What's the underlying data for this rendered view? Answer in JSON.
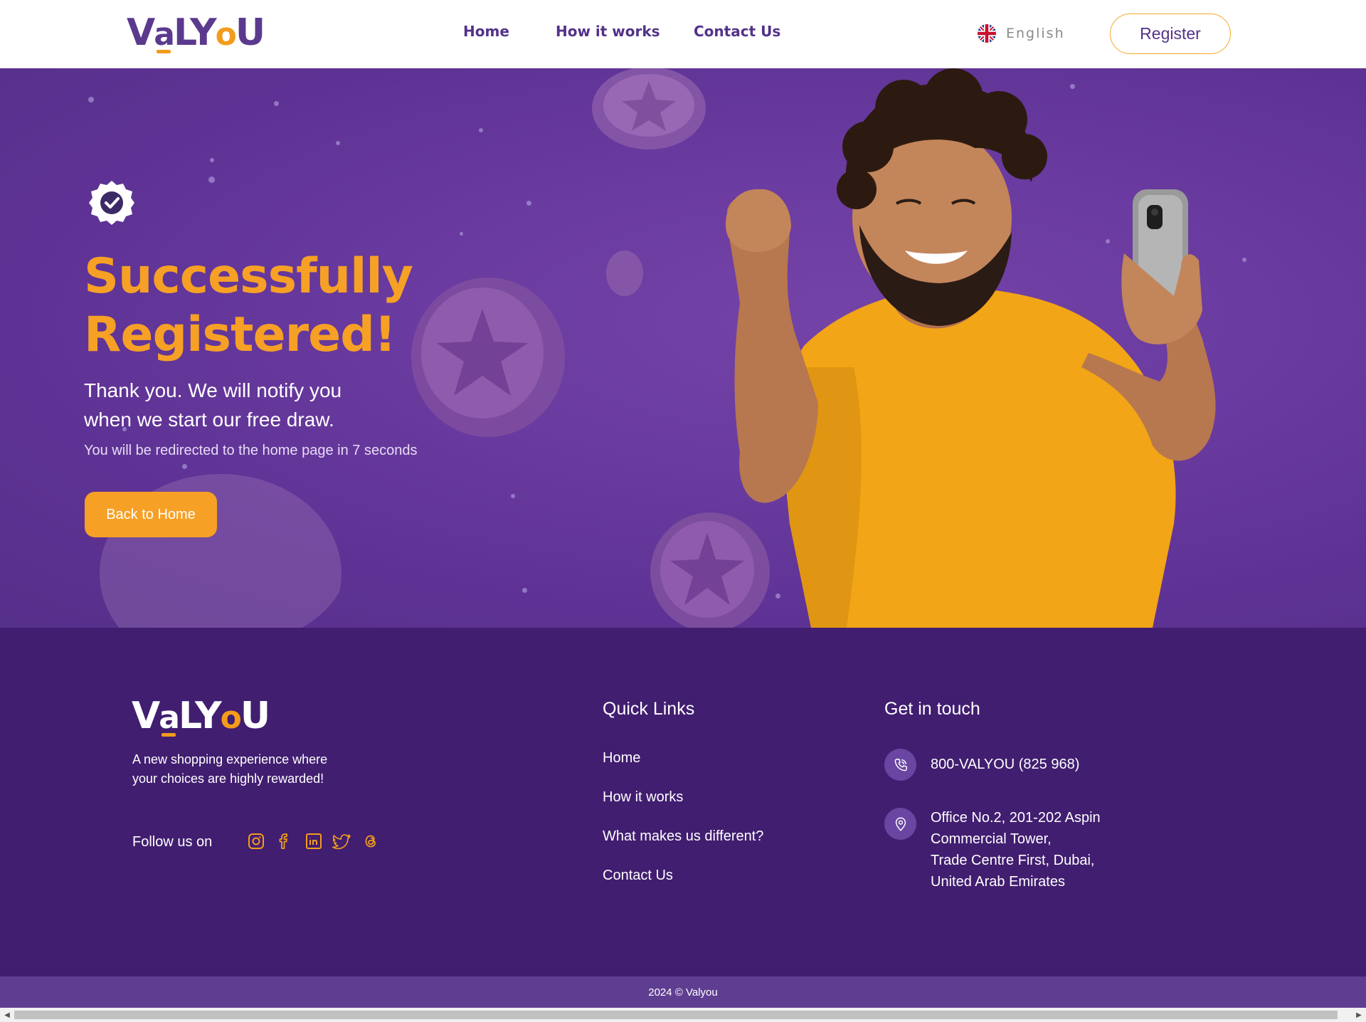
{
  "header": {
    "logo": "VaLYoU",
    "nav": [
      "Home",
      "How it works",
      "Contact Us"
    ],
    "language": "English",
    "register_label": "Register"
  },
  "hero": {
    "icon": "verified-badge-icon",
    "title_line1": "Successfully",
    "title_line2": "Registered!",
    "subtitle_line1": "Thank you. We will notify you",
    "subtitle_line2": "when we start our free draw.",
    "redirect_text": "You will be redirected to the home page in 7 seconds",
    "back_label": "Back to Home",
    "image": "smiling man in yellow t-shirt holding phone"
  },
  "footer": {
    "logo": "VaLYoU",
    "tagline_line1": "A new shopping experience where",
    "tagline_line2": "your choices are highly rewarded!",
    "follow_label": "Follow us on",
    "social": [
      "instagram-icon",
      "facebook-icon",
      "linkedin-icon",
      "twitter-icon",
      "threads-icon"
    ],
    "quick_links_title": "Quick Links",
    "quick_links": [
      "Home",
      "How it works",
      "What makes us different?",
      "Contact Us"
    ],
    "contact_title": "Get in touch",
    "phone": "800-VALYOU (825 968)",
    "address_line1": "Office No.2, 201-202 Aspin",
    "address_line2": "Commercial Tower,",
    "address_line3": "Trade Centre First, Dubai,",
    "address_line4": "United Arab Emirates",
    "copyright": "2024 © Valyou"
  },
  "colors": {
    "brand_purple": "#53328a",
    "accent_orange": "#f6a026",
    "hero_purple": "#6a3ba0",
    "footer_purple": "#411e70"
  }
}
